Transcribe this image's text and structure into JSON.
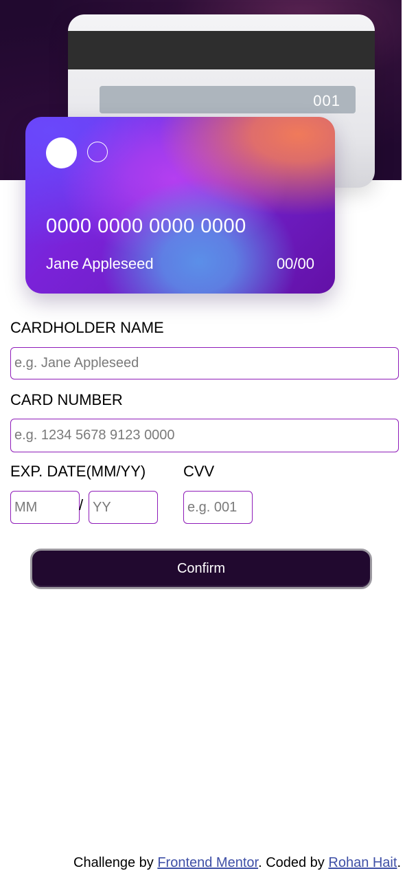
{
  "card_back": {
    "cvv": "001"
  },
  "card_front": {
    "number": "0000 0000 0000 0000",
    "name": "Jane Appleseed",
    "expiry": "00/00"
  },
  "form": {
    "cardholder_label": "CARDHOLDER NAME",
    "cardholder_placeholder": "e.g. Jane Appleseed",
    "number_label": "CARD NUMBER",
    "number_placeholder": "e.g. 1234 5678 9123 0000",
    "expiry_label": "EXP. DATE(MM/YY)",
    "month_placeholder": "MM",
    "year_placeholder": "YY",
    "date_separator": "/",
    "cvv_label": "CVV",
    "cvv_placeholder": "e.g. 001",
    "confirm_label": "Confirm"
  },
  "footer": {
    "prefix": "Challenge by ",
    "link1": "Frontend Mentor",
    "middle": ". Coded by ",
    "link2": "Rohan Hait",
    "suffix": "."
  },
  "colors": {
    "banner_bg": "#21092f",
    "input_border": "#8e1bb8",
    "button_bg": "#21092f",
    "link": "#3e4fa6"
  }
}
